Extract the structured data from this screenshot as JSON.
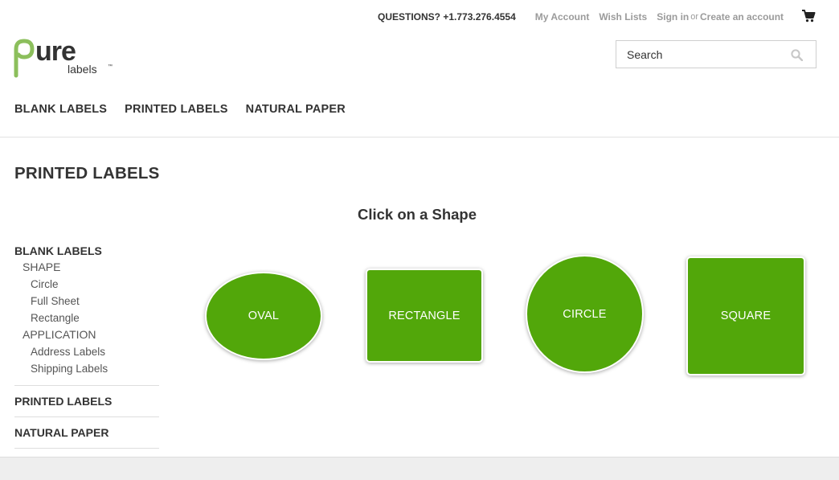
{
  "topbar": {
    "questions": "QUESTIONS? +1.773.276.4554",
    "my_account": "My Account",
    "wish_lists": "Wish Lists",
    "sign_in": "Sign in",
    "or": "or",
    "create_account": "Create an account",
    "cart_icon": "cart-icon"
  },
  "logo": {
    "word": "ure",
    "letter": "p",
    "sub": "labels",
    "tm": "™",
    "accent_color": "#8cbf5c",
    "dark_color": "#333333"
  },
  "search": {
    "placeholder": "Search",
    "icon": "search-icon"
  },
  "nav": {
    "items": [
      "BLANK LABELS",
      "PRINTED LABELS",
      "NATURAL PAPER"
    ]
  },
  "page": {
    "title": "PRINTED LABELS",
    "shape_prompt": "Click on a Shape"
  },
  "sidebar": {
    "blank_labels": "BLANK LABELS",
    "shape": "SHAPE",
    "shape_items": [
      "Circle",
      "Full Sheet",
      "Rectangle"
    ],
    "application": "APPLICATION",
    "application_items": [
      "Address Labels",
      "Shipping Labels"
    ],
    "printed_labels": "PRINTED LABELS",
    "natural_paper": "NATURAL PAPER"
  },
  "shapes": {
    "oval": "OVAL",
    "rectangle": "RECTANGLE",
    "circle": "CIRCLE",
    "square": "SQUARE",
    "color": "#52a70a"
  }
}
